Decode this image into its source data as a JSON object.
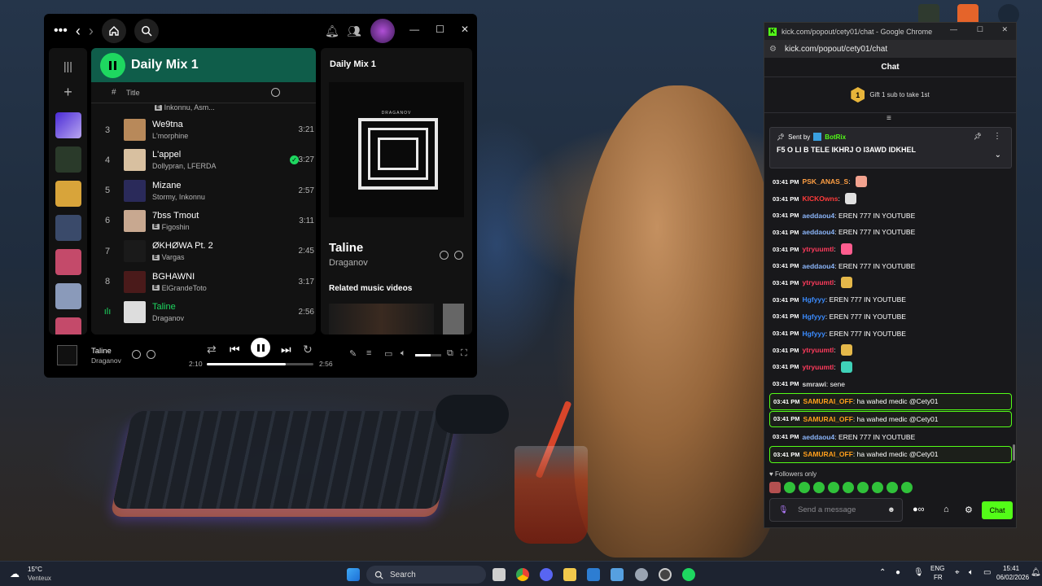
{
  "spotify": {
    "playlist_title": "Daily Mix 1",
    "col_hash": "#",
    "col_title": "Title",
    "partial_row_artist": "Inkonnu, Asm...",
    "tracks": [
      {
        "num": "3",
        "title": "We9tna",
        "artist": "L'morphine",
        "explicit": false,
        "duration": "3:21",
        "liked": false
      },
      {
        "num": "4",
        "title": "L'appel",
        "artist": "Dollypran, LFERDA",
        "explicit": false,
        "duration": "3:27",
        "liked": true
      },
      {
        "num": "5",
        "title": "Mizane",
        "artist": "Stormy, Inkonnu",
        "explicit": false,
        "duration": "2:57",
        "liked": false
      },
      {
        "num": "6",
        "title": "7bss Tmout",
        "artist": "Figoshin",
        "explicit": true,
        "duration": "3:11",
        "liked": false
      },
      {
        "num": "7",
        "title": "ØKHØWA Pt. 2",
        "artist": "Vargas",
        "explicit": true,
        "duration": "2:45",
        "liked": false
      },
      {
        "num": "8",
        "title": "BGHAWNI",
        "artist": "ElGrandeToto",
        "explicit": true,
        "duration": "3:17",
        "liked": false
      },
      {
        "num": "",
        "title": "Taline",
        "artist": "Draganov",
        "explicit": false,
        "duration": "2:56",
        "liked": false,
        "playing": true
      }
    ],
    "explicit_badge": "E",
    "right_panel": {
      "header": "Daily Mix 1",
      "cover_label": "DRAGANOV",
      "song_title": "Taline",
      "song_artist": "Draganov",
      "related_label": "Related music videos"
    },
    "now_playing": {
      "title": "Taline",
      "artist": "Draganov",
      "elapsed": "2:10",
      "total": "2:56",
      "progress": 0.74
    }
  },
  "chrome": {
    "window_title": "kick.com/popout/cety01/chat - Google Chrome",
    "url": "kick.com/popout/cety01/chat",
    "chat_header": "Chat",
    "gift_badge": "1",
    "gift_text": "Gift 1 sub to take 1st",
    "pinned": {
      "sent_by": "Sent by",
      "author": "BotRix",
      "text": "F5 O LI B TELE IKHRJ O I3AWD IDKHEL"
    },
    "messages": [
      {
        "time": "03:41 PM",
        "user": "PSK_ANAS_S",
        "color": "#ff9f43",
        "text": "",
        "emote": "#f2a28f",
        "hl": false
      },
      {
        "time": "03:41 PM",
        "user": "KICKOwns",
        "color": "#ff3b3b",
        "text": "",
        "emote": "#e0e0e0",
        "hl": false
      },
      {
        "time": "03:41 PM",
        "user": "aeddaou4",
        "color": "#8ab4f8",
        "text": "EREN 777 IN YOUTUBE",
        "emote": "",
        "hl": false
      },
      {
        "time": "03:41 PM",
        "user": "aeddaou4",
        "color": "#8ab4f8",
        "text": "EREN 777 IN YOUTUBE",
        "emote": "",
        "hl": false
      },
      {
        "time": "03:41 PM",
        "user": "ytryuumtl",
        "color": "#ff3b5c",
        "text": "",
        "emote": "#ff5d8f",
        "hl": false
      },
      {
        "time": "03:41 PM",
        "user": "aeddaou4",
        "color": "#8ab4f8",
        "text": "EREN 777 IN YOUTUBE",
        "emote": "",
        "hl": false
      },
      {
        "time": "03:41 PM",
        "user": "ytryuumtl",
        "color": "#ff3b5c",
        "text": "",
        "emote": "#e5b84a",
        "hl": false
      },
      {
        "time": "03:41 PM",
        "user": "Hgfyyy",
        "color": "#3b8cff",
        "text": "EREN 777 IN YOUTUBE",
        "emote": "",
        "hl": false
      },
      {
        "time": "03:41 PM",
        "user": "Hgfyyy",
        "color": "#3b8cff",
        "text": "EREN 777 IN YOUTUBE",
        "emote": "",
        "hl": false
      },
      {
        "time": "03:41 PM",
        "user": "Hgfyyy",
        "color": "#3b8cff",
        "text": "EREN 777 IN YOUTUBE",
        "emote": "",
        "hl": false
      },
      {
        "time": "03:41 PM",
        "user": "ytryuumtl",
        "color": "#ff3b5c",
        "text": "",
        "emote": "#e5b84a",
        "hl": false
      },
      {
        "time": "03:41 PM",
        "user": "ytryuumtl",
        "color": "#ff3b5c",
        "text": "",
        "emote": "#3fd1b8",
        "hl": false
      },
      {
        "time": "03:41 PM",
        "user": "smrawi",
        "color": "#dddddd",
        "text": "sene",
        "emote": "",
        "hl": false
      },
      {
        "time": "03:41 PM",
        "user": "SAMURAI_OFF",
        "color": "#ff9f1c",
        "text": "ha wahed medic @Cety01",
        "emote": "",
        "hl": true
      },
      {
        "time": "03:41 PM",
        "user": "SAMURAI_OFF",
        "color": "#ff9f1c",
        "text": "ha wahed medic @Cety01",
        "emote": "",
        "hl": true
      },
      {
        "time": "03:41 PM",
        "user": "aeddaou4",
        "color": "#8ab4f8",
        "text": "EREN 777 IN YOUTUBE",
        "emote": "",
        "hl": false
      },
      {
        "time": "03:41 PM",
        "user": "SAMURAI_OFF",
        "color": "#ff9f1c",
        "text": "ha wahed medic @Cety01",
        "emote": "",
        "hl": true
      }
    ],
    "followers_only": "Followers only",
    "placeholder": "Send a message",
    "chat_button": "Chat"
  },
  "taskbar": {
    "temp": "15°C",
    "weather": "Venteux",
    "search": "Search",
    "lang1": "ENG",
    "lang2": "FR",
    "time": "15:41",
    "date": "06/02/2026"
  },
  "colors": {
    "spotify_green": "#1ed760",
    "kick_green": "#53fc18",
    "mix_header": "#0f5d4a"
  }
}
